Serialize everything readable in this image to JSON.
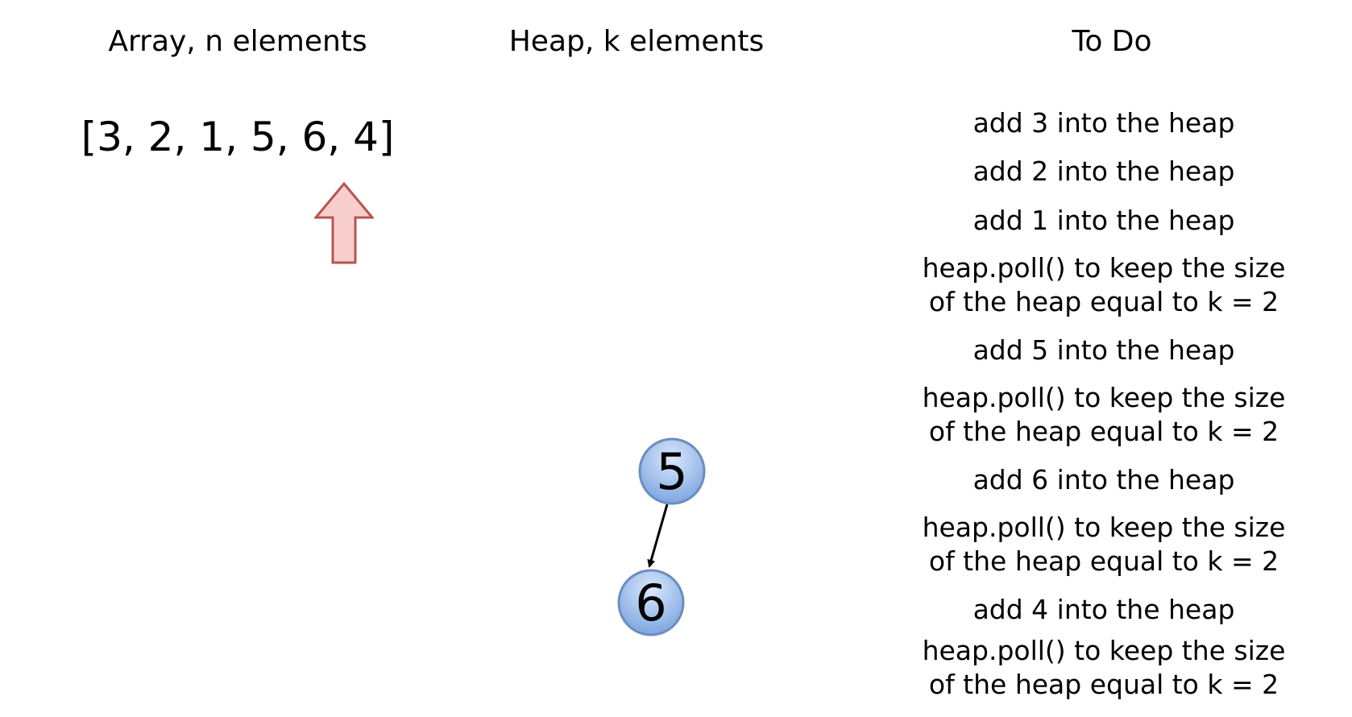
{
  "headings": {
    "array": "Array, n elements",
    "heap": "Heap, k elements",
    "todo": "To Do"
  },
  "array": {
    "text": "[3, 2, 1, 5, 6, 4]"
  },
  "heap": {
    "nodes": [
      {
        "value": "5"
      },
      {
        "value": "6"
      }
    ]
  },
  "todo": {
    "steps": [
      "add 3 into the heap",
      "add 2 into the heap",
      "add 1 into the heap",
      "heap.poll() to keep the size\nof the heap equal to k = 2",
      "add 5 into the heap",
      "heap.poll() to keep the size\nof the heap equal to k = 2",
      "add 6 into the heap",
      "heap.poll() to keep the size\nof the heap equal to k = 2",
      "add 4 into the heap",
      "heap.poll() to keep the size\nof the heap equal to k = 2"
    ]
  },
  "colors": {
    "arrow_fill": "#f8cecc",
    "arrow_stroke": "#b85450",
    "node_fill_light": "#dae8fc",
    "node_fill_dark": "#7ea6e0",
    "node_stroke": "#6c8ebf",
    "edge": "#000000"
  }
}
